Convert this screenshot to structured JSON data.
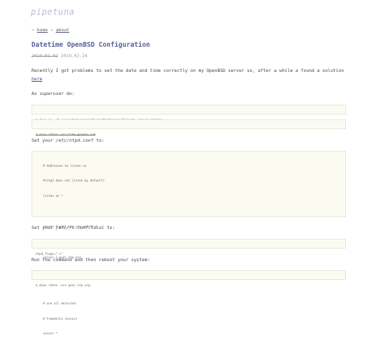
{
  "site": {
    "title": "pipetuna"
  },
  "nav": {
    "prefix": "~",
    "separator": "~",
    "home": "home",
    "about": "about"
  },
  "post": {
    "title": "Datetime OpenBSD Configuration",
    "date_original": "2019.01.02",
    "date_updated": "2019.02.24"
  },
  "intro": {
    "text": "Recently I got problems to set the date and time correctly on my OpenBSD server so, after a while a found a solution",
    "link": "here"
  },
  "superuser": {
    "before": "As ",
    "emph": "superuser",
    "after": " do:"
  },
  "code1": {
    "line": "$ doas ln -sf /usr/share/zoneinfo/right/America/Toronto /etc/localtime"
  },
  "code2": {
    "line": "$ doas rdate -ncv time.google.com"
  },
  "ntpd": {
    "before": "Set your ",
    "emph": "/etc/ntpd.conf",
    "after": " to:"
  },
  "code3": {
    "lines": [
      "    # Addresses to listen on",
      "    #(ntpd does not listen by default)",
      "    listen on *",
      "",
      "    server 0.pool.ntp.org weight 5",
      "    server 1.pool.ntp.org",
      "    server 2.pool.ntp.org",
      "    server 3.pool.ntp.org",
      "",
      "    # use all detected",
      "    # timedelta sensors",
      "    sensor *"
    ]
  },
  "rcconf": {
    "before": "Set your ",
    "emph": "/etc/rc.conf.local",
    "after": " to:"
  },
  "code4": {
    "line": "ntpd_flags=\"-s\""
  },
  "reboot": {
    "text": "Run the command and then reboot your system:"
  },
  "code5": {
    "line": "$ doas rdate -ncv pool.ntp.org"
  }
}
